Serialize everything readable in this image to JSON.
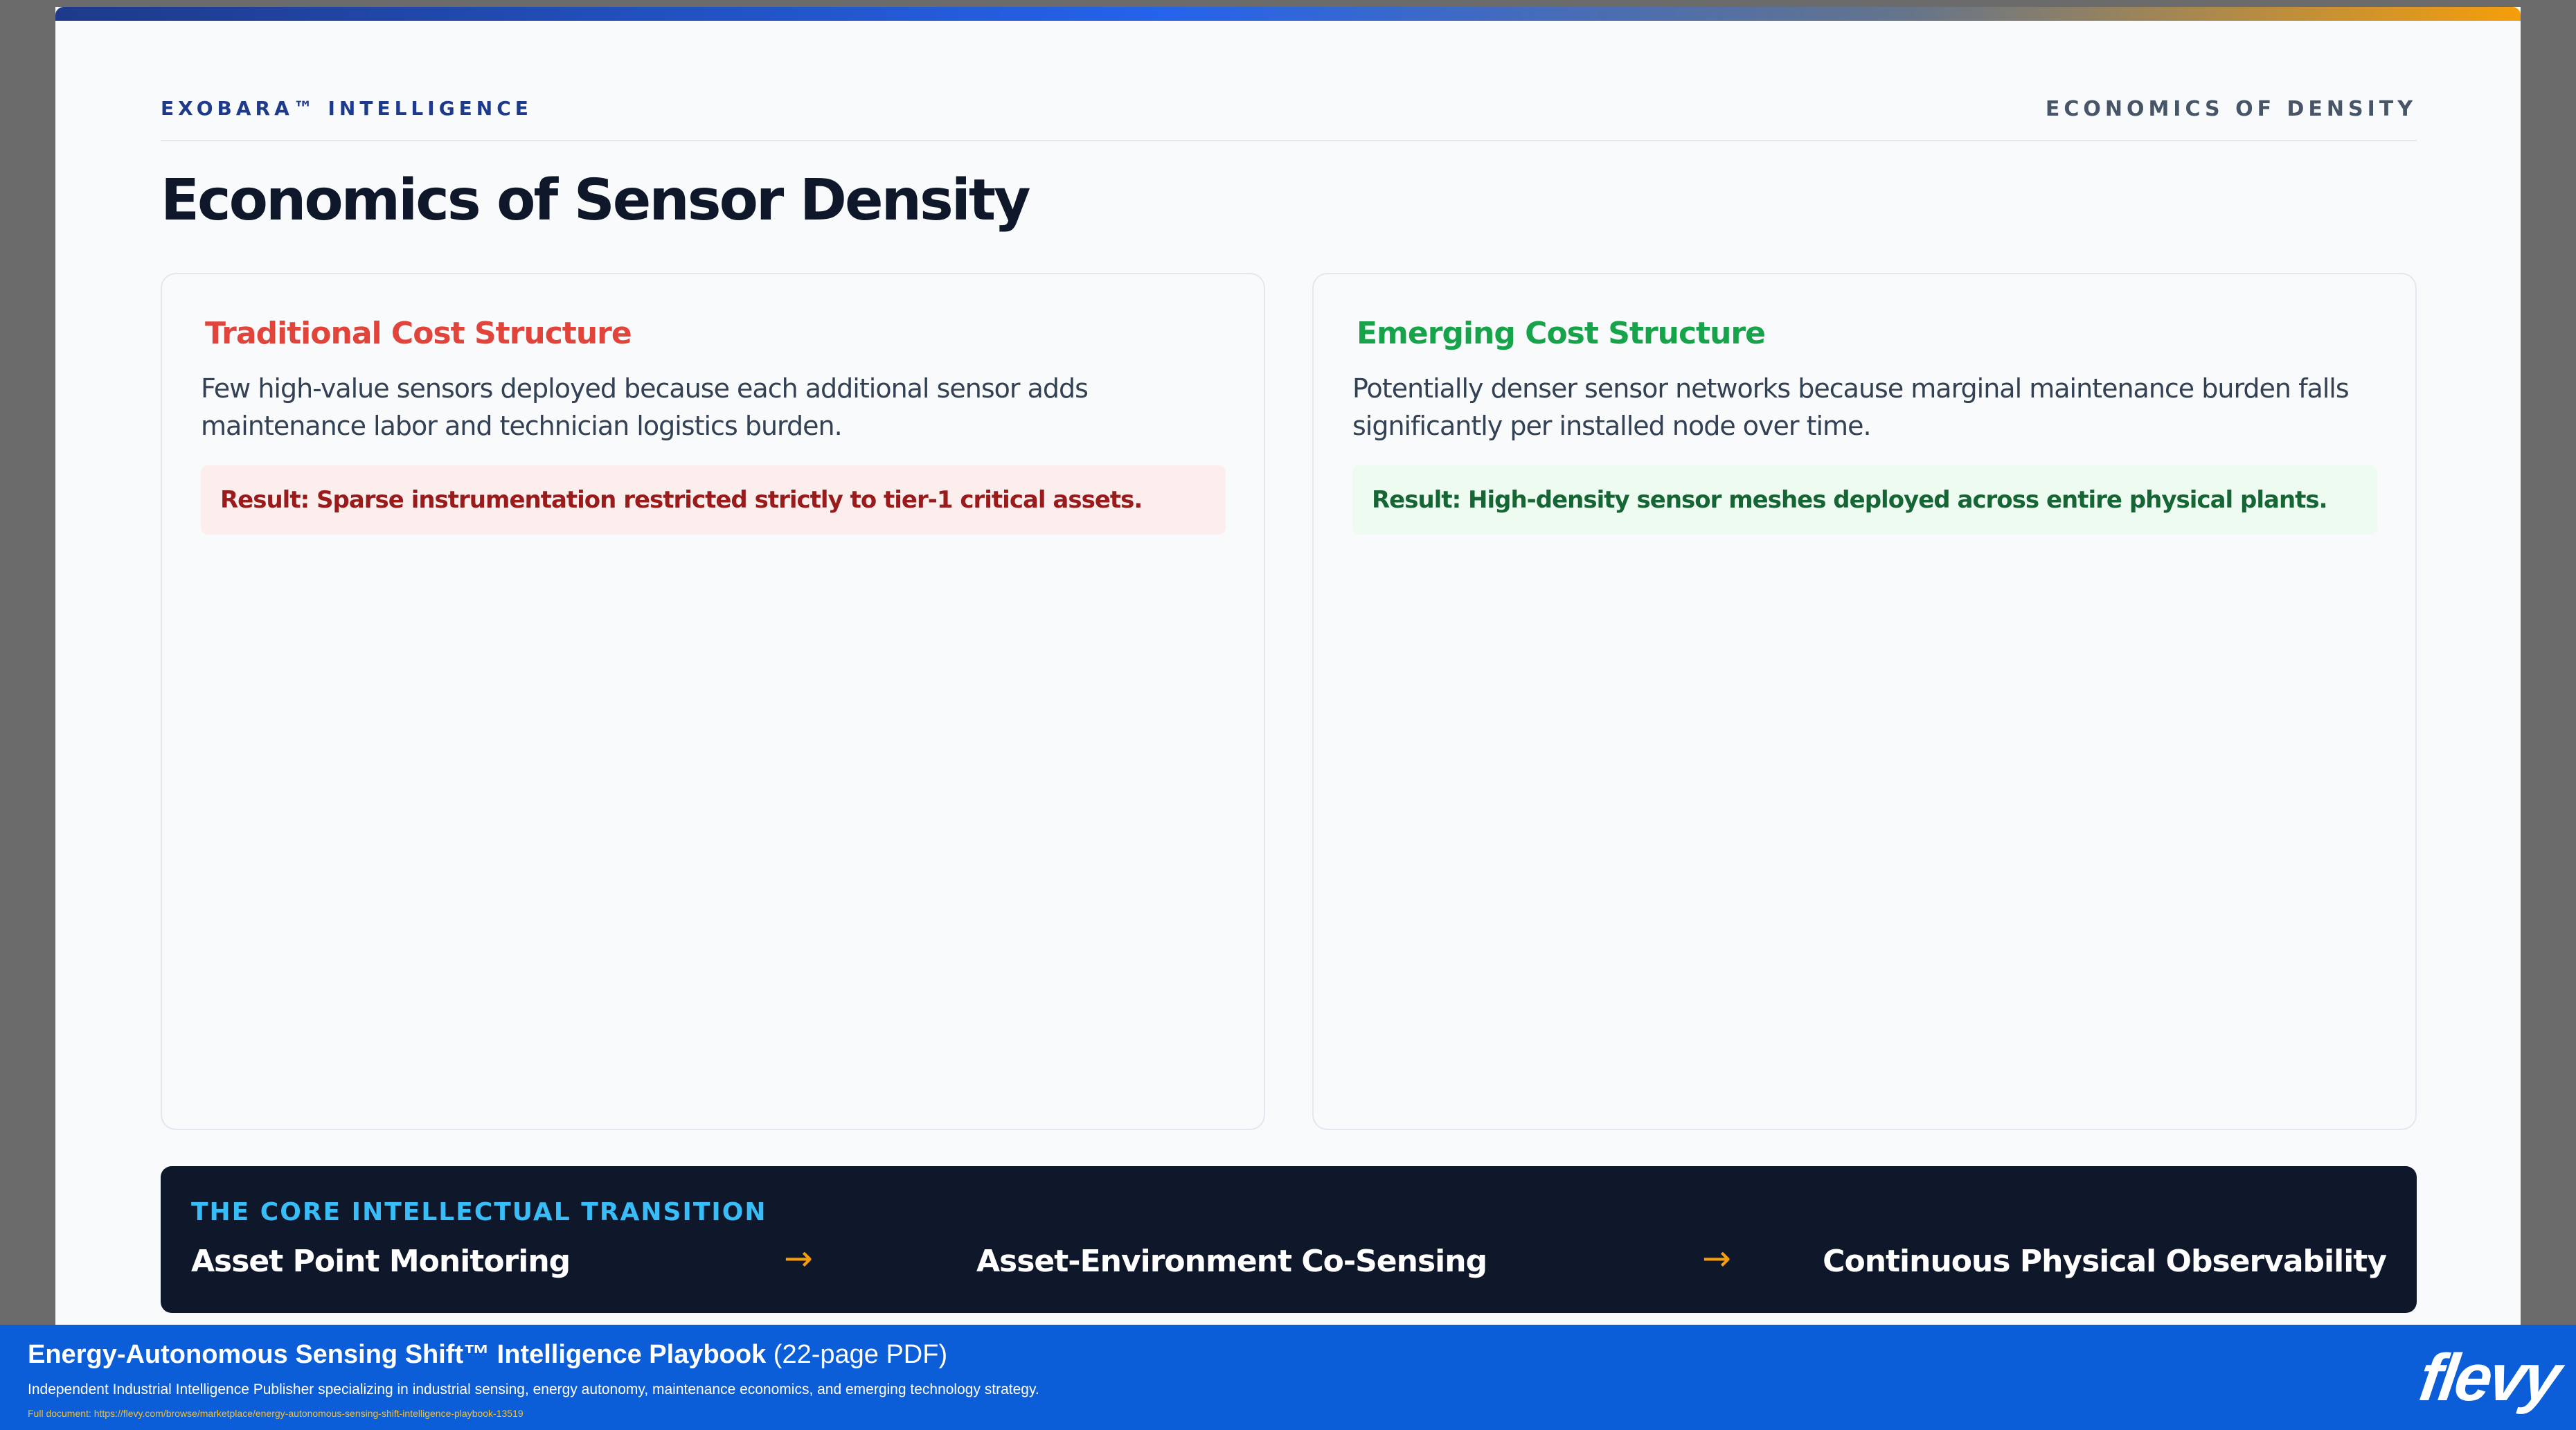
{
  "slide": {
    "brand": "EXOBARA™ INTELLIGENCE",
    "section_tag": "ECONOMICS OF DENSITY",
    "title": "Economics of Sensor Density",
    "traditional": {
      "heading": "Traditional Cost Structure",
      "body": "Few high-value sensors deployed because each additional sensor adds maintenance labor and technician logistics burden.",
      "result": "Result: Sparse instrumentation restricted strictly to tier-1 critical assets."
    },
    "emerging": {
      "heading": "Emerging Cost Structure",
      "body": "Potentially denser sensor networks because marginal maintenance burden falls significantly per installed node over time.",
      "result": "Result: High-density sensor meshes deployed across entire physical plants."
    },
    "transition": {
      "label": "THE CORE INTELLECTUAL TRANSITION",
      "stages": [
        "Asset Point Monitoring",
        "Asset-Environment Co-Sensing",
        "Continuous Physical Observability"
      ],
      "arrow_glyph": "→"
    }
  },
  "footer": {
    "title": "Energy-Autonomous Sensing Shift™ Intelligence Playbook",
    "title_suffix": "(22-page PDF)",
    "subtitle": "Independent Industrial Intelligence Publisher specializing in industrial sensing, energy autonomy, maintenance economics, and emerging technology strategy.",
    "link": "Full document: https://flevy.com/browse/marketplace/energy-autonomous-sensing-shift-intelligence-playbook-13519",
    "logo": "flevy"
  },
  "colors": {
    "traditional_accent": "#e0443a",
    "emerging_accent": "#16a34a",
    "transition_bg": "#0f172a",
    "transition_label": "#38bdf8",
    "arrow": "#f59e0b",
    "footer_bg": "#0b5ed7"
  }
}
